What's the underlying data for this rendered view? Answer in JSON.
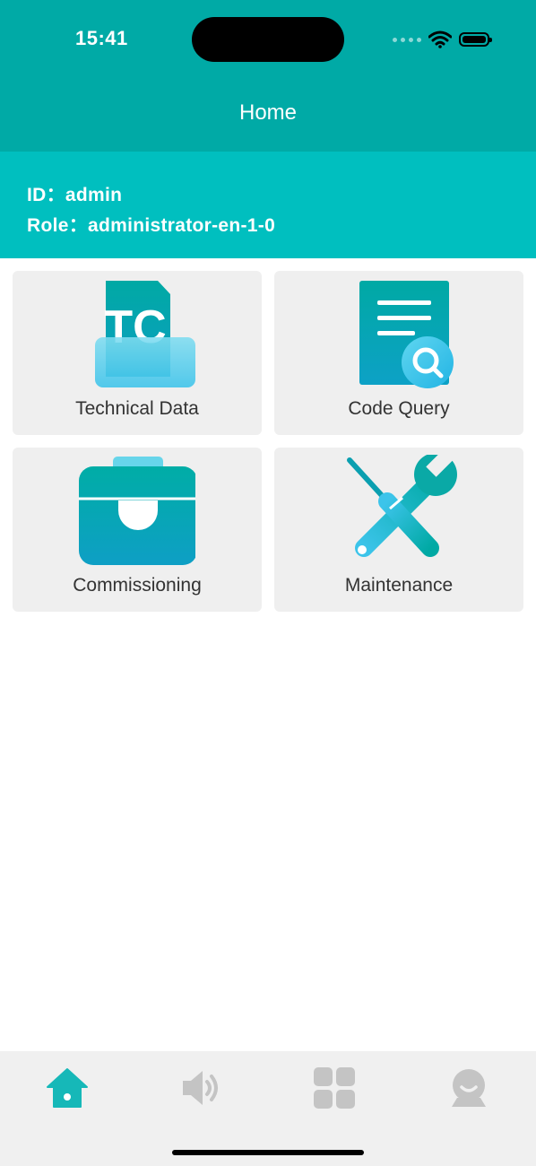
{
  "status_bar": {
    "time": "15:41"
  },
  "header": {
    "title": "Home"
  },
  "user": {
    "id_line": "ID：admin",
    "role_line": "Role：administrator-en-1-0"
  },
  "menu": [
    {
      "label": "Technical Data",
      "icon": "technical-data-icon"
    },
    {
      "label": "Code Query",
      "icon": "code-query-icon"
    },
    {
      "label": "Commissioning",
      "icon": "commissioning-icon"
    },
    {
      "label": "Maintenance",
      "icon": "maintenance-icon"
    }
  ],
  "technical_icon_text": "TC",
  "tabs": [
    {
      "icon": "home-icon",
      "active": true
    },
    {
      "icon": "speaker-icon",
      "active": false
    },
    {
      "icon": "grid-icon",
      "active": false
    },
    {
      "icon": "profile-icon",
      "active": false
    }
  ],
  "colors": {
    "header": "#00aaa6",
    "user_panel": "#00bfbf",
    "active_tab": "#16b8b8",
    "inactive_tab": "#c4c4c4"
  }
}
